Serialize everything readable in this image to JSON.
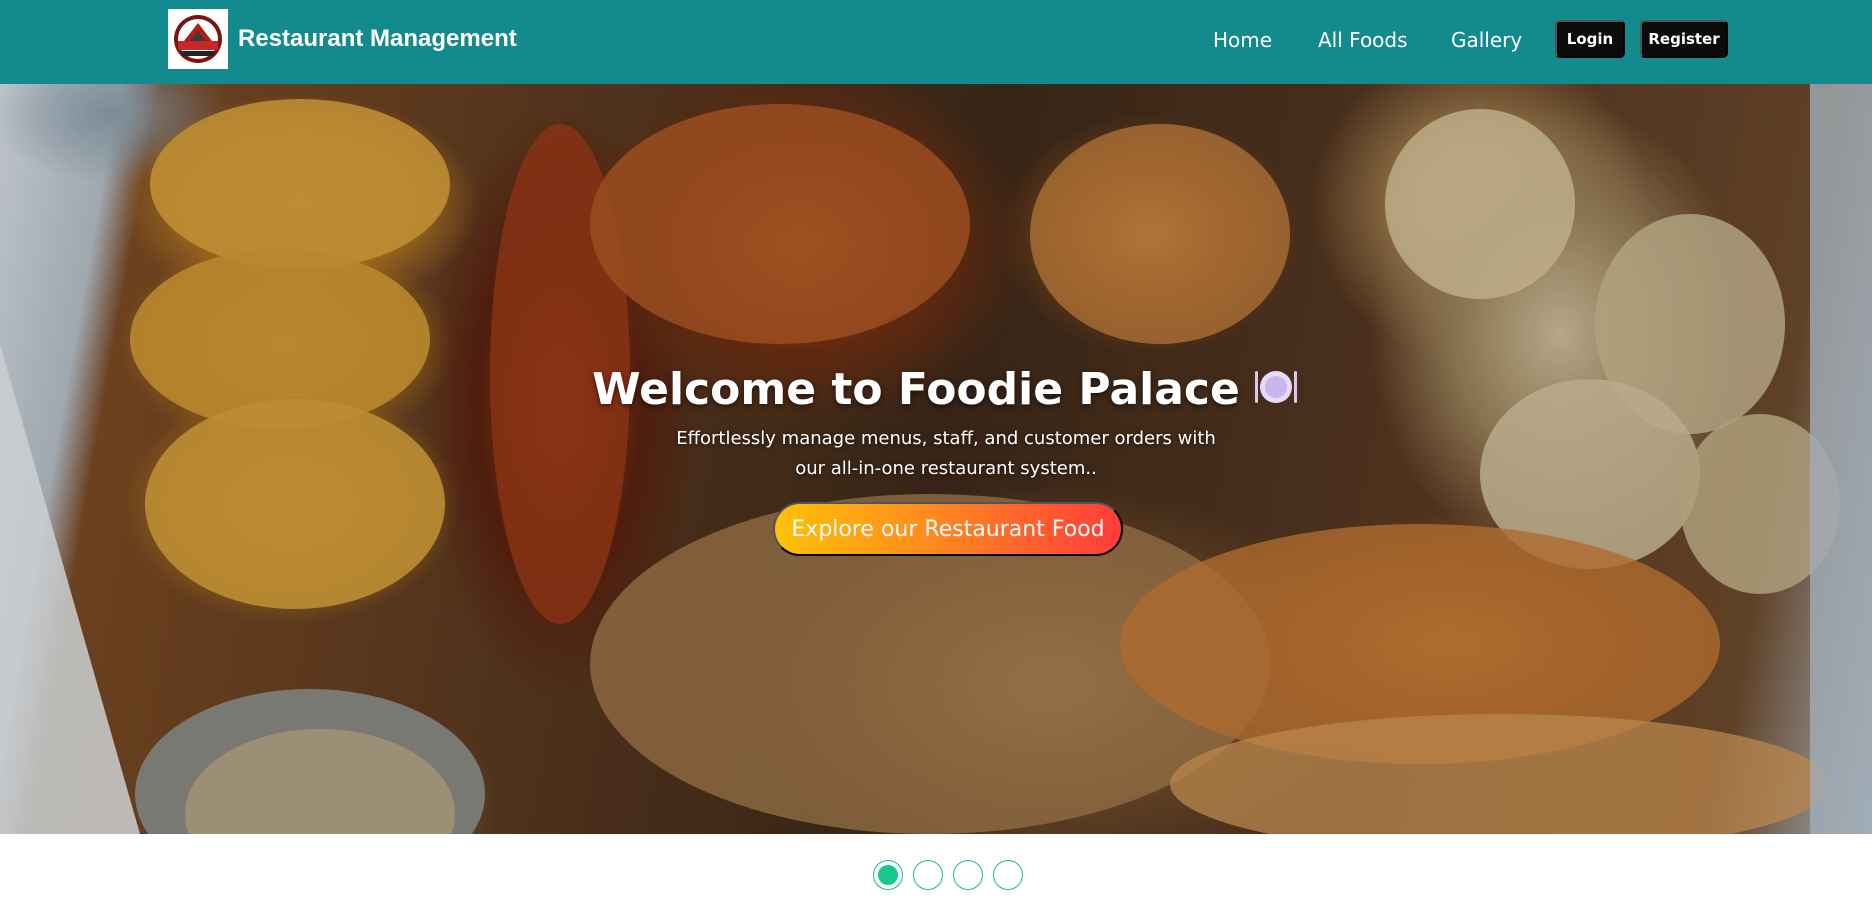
{
  "navbar": {
    "brand": "Restaurant Management",
    "logo_icon": "restaurant-logo-icon",
    "background_color": "#138a8e",
    "links": [
      {
        "label": "Home"
      },
      {
        "label": "All Foods"
      },
      {
        "label": "Gallery"
      }
    ],
    "login_label": "Login",
    "register_label": "Register"
  },
  "hero": {
    "title": "Welcome to Foodie Palace",
    "title_icon": "plate-icon",
    "subtitle": "Effortlessly manage menus, staff, and customer orders with our all-in-one restaurant system..",
    "cta_label": "Explore our Restaurant Food",
    "background_image": "seafood-platter-photo"
  },
  "carousel": {
    "slides": 4,
    "active_index": 0,
    "accent_color": "#16c88e"
  }
}
